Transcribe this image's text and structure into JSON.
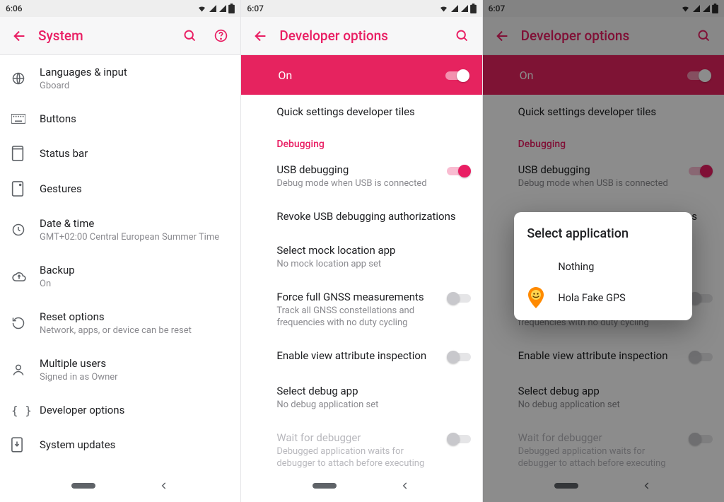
{
  "pane1": {
    "status_time": "6:06",
    "title": "System",
    "items": [
      {
        "label": "Languages & input",
        "sub": "Gboard",
        "icon": "globe"
      },
      {
        "label": "Buttons",
        "sub": "",
        "icon": "keyboard"
      },
      {
        "label": "Status bar",
        "sub": "",
        "icon": "rect"
      },
      {
        "label": "Gestures",
        "sub": "",
        "icon": "gesture"
      },
      {
        "label": "Date & time",
        "sub": "GMT+02:00 Central European Summer Time",
        "icon": "clock"
      },
      {
        "label": "Backup",
        "sub": "On",
        "icon": "cloud"
      },
      {
        "label": "Reset options",
        "sub": "Network, apps, or device can be reset",
        "icon": "reset"
      },
      {
        "label": "Multiple users",
        "sub": "Signed in as Owner",
        "icon": "user"
      },
      {
        "label": "Developer options",
        "sub": "",
        "icon": "braces"
      },
      {
        "label": "System updates",
        "sub": "",
        "icon": "update"
      }
    ]
  },
  "pane2": {
    "status_time": "6:07",
    "title": "Developer options",
    "big_switch_label": "On",
    "quick_tiles": "Quick settings developer tiles",
    "section_debugging": "Debugging",
    "usb_debug_label": "USB debugging",
    "usb_debug_sub": "Debug mode when USB is connected",
    "revoke_label": "Revoke USB debugging authorizations",
    "mock_label": "Select mock location app",
    "mock_sub": "No mock location app set",
    "gnss_label": "Force full GNSS measurements",
    "gnss_sub": "Track all GNSS constellations and frequencies with no duty cycling",
    "view_attr_label": "Enable view attribute inspection",
    "debug_app_label": "Select debug app",
    "debug_app_sub": "No debug application set",
    "wait_label": "Wait for debugger",
    "wait_sub": "Debugged application waits for debugger to attach before executing"
  },
  "pane3": {
    "status_time": "6:07",
    "title": "Developer options",
    "dialog_title": "Select application",
    "dialog_items": [
      {
        "label": "Nothing"
      },
      {
        "label": "Hola Fake GPS"
      }
    ]
  }
}
